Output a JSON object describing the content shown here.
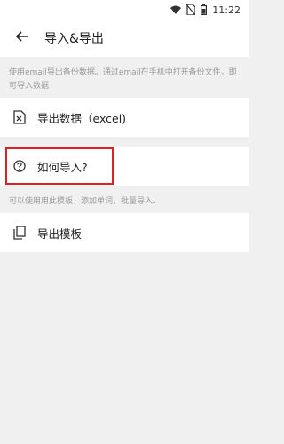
{
  "status_bar": {
    "time": "11:22",
    "icons": [
      "wifi-icon",
      "no-sim-icon",
      "battery-icon"
    ]
  },
  "app_bar": {
    "title": "导入&导出",
    "back_icon": "arrow-back-icon"
  },
  "sections": {
    "export_caption": "使用email导出备份数据。通过email在手机中打开备份文件，即可导入数据",
    "export_data_label": "导出数据（excel)",
    "how_to_import_label": "如何导入?",
    "template_caption": "可以使用用此模板，添加单词，批量导入。",
    "export_template_label": "导出模板"
  },
  "colors": {
    "highlight": "#e02020",
    "background": "#f0f0f0",
    "caption": "#9a9a9a"
  }
}
